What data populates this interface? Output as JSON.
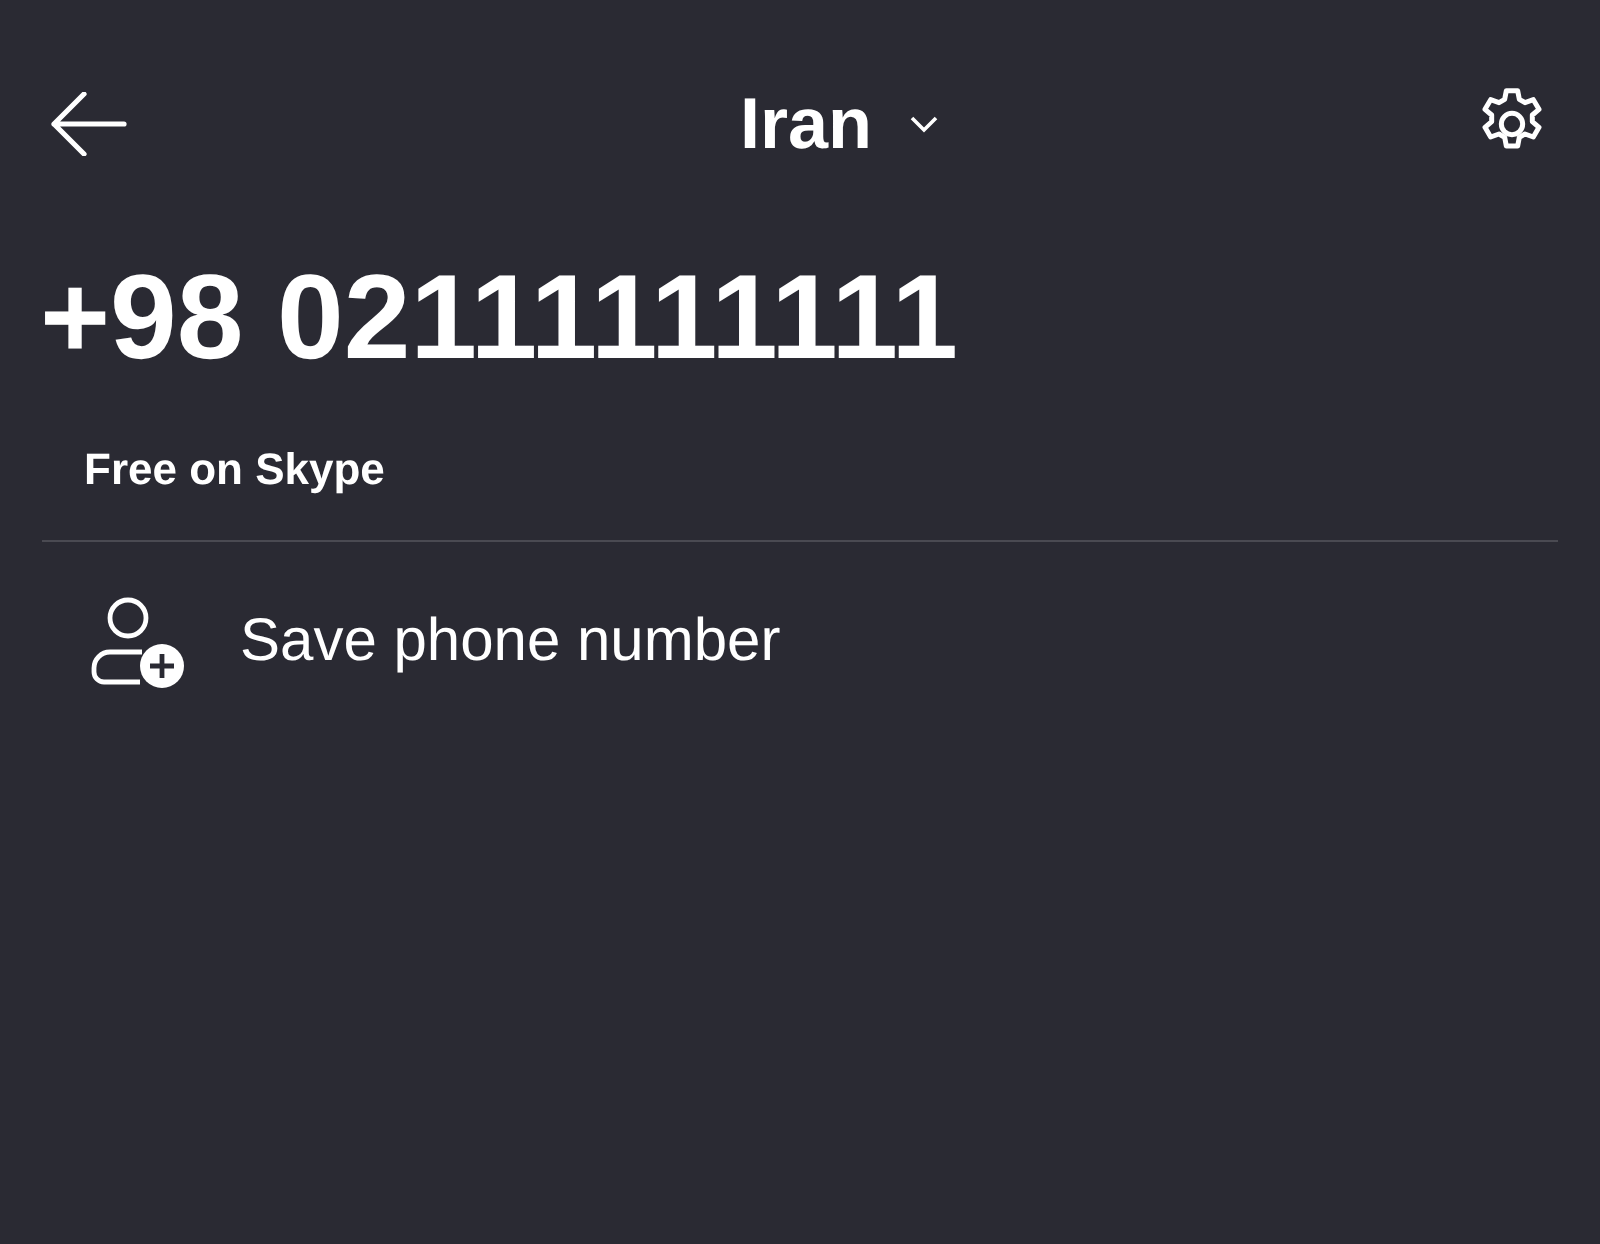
{
  "header": {
    "title": "Iran"
  },
  "number": "+98 02111111111",
  "status": "Free on Skype",
  "actions": [
    {
      "label": "Save phone number"
    }
  ]
}
